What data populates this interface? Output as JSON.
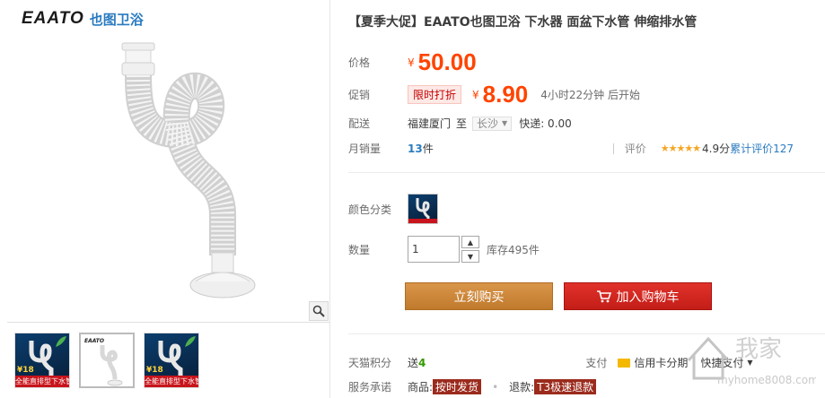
{
  "brand": {
    "logo_text": "EAATO",
    "logo_cn": "也图卫浴"
  },
  "gallery": {
    "thumbs": [
      {
        "price": "¥18",
        "banner": "全能直排型下水管"
      },
      {
        "mini_brand": "EAATO"
      },
      {
        "price": "¥18",
        "banner": "全能直排型下水管"
      }
    ]
  },
  "product": {
    "title": "【夏季大促】EAATO也图卫浴 下水器 面盆下水管 伸缩排水管",
    "price_label": "价格",
    "currency": "¥",
    "price": "50.00",
    "promo_label": "促销",
    "promo_tag": "限时打折",
    "promo_price": "8.90",
    "countdown": "4小时22分钟 后开始",
    "ship_label": "配送",
    "ship_from": "福建厦门",
    "ship_to_word": "至",
    "ship_to": "长沙",
    "express": "快递: 0.00",
    "sales_label": "月销量",
    "sales_count": "13",
    "sales_unit": "件",
    "rating_label": "评价",
    "rating_stars": "★★★★★",
    "rating_score": "4.9分",
    "rating_link": "累计评价127",
    "color_label": "颜色分类",
    "qty_label": "数量",
    "qty_value": "1",
    "stock": "库存495件",
    "buy_now": "立刻购买",
    "add_cart": "加入购物车",
    "points_label": "天猫积分",
    "points_text": "送",
    "points_value": "4",
    "pay_label": "支付",
    "pay_options": [
      "信用卡分期",
      "快捷支付"
    ],
    "service_label": "服务承诺",
    "service_goods": "商品:",
    "service_goods_tag": "按时发货",
    "service_refund": "退款:",
    "service_refund_tag": "T3极速退款"
  },
  "watermark": {
    "text": "我家",
    "url": "myhome8008.com"
  },
  "colors": {
    "price": "#ff4400",
    "buy": "#c8843a",
    "cart": "#d3231c",
    "link": "#2a7bc0"
  }
}
